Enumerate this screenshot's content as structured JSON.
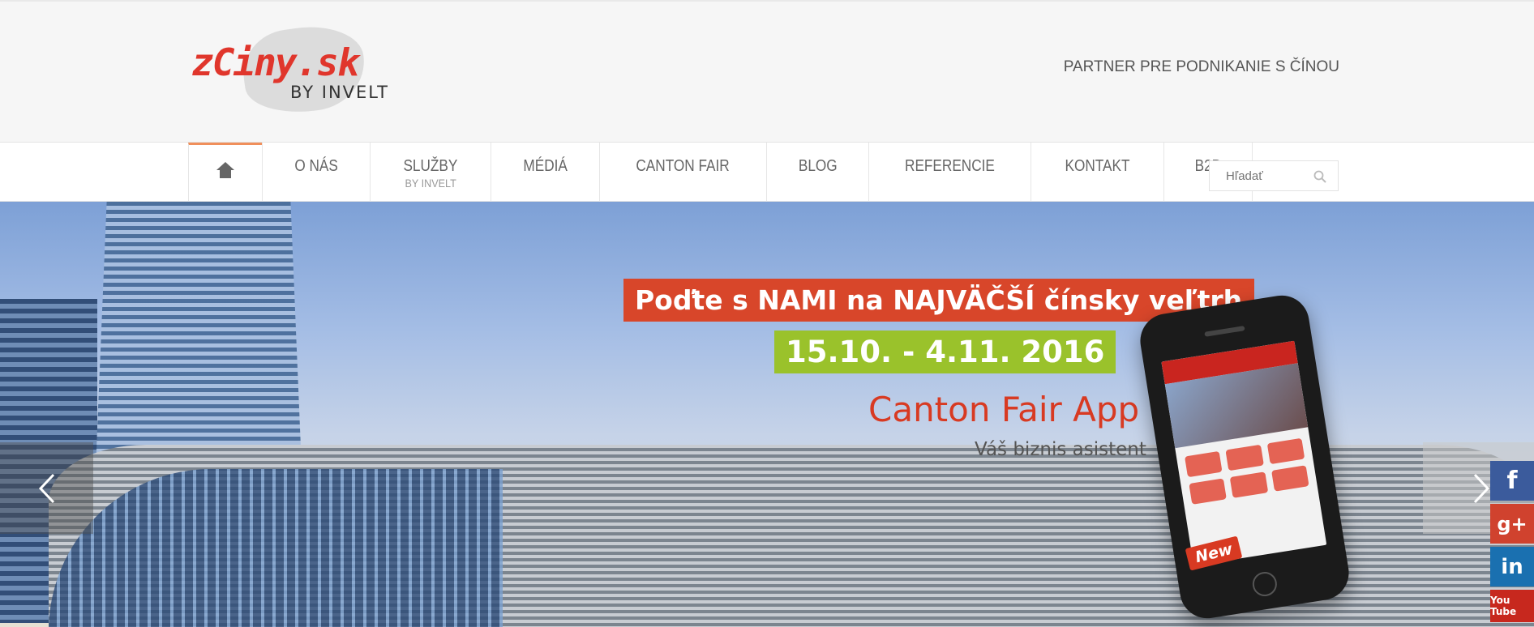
{
  "header": {
    "logo_brand": "zCiny.sk",
    "logo_sub": "BY INVELT",
    "tagline": "PARTNER PRE PODNIKANIE S ČÍNOU"
  },
  "nav": {
    "items": [
      {
        "label": "",
        "icon": "home-icon"
      },
      {
        "label": "O NÁS"
      },
      {
        "label": "SLUŽBY",
        "sub": "BY INVELT"
      },
      {
        "label": "MÉDIÁ"
      },
      {
        "label": "CANTON FAIR"
      },
      {
        "label": "BLOG"
      },
      {
        "label": "REFERENCIE"
      },
      {
        "label": "KONTAKT"
      },
      {
        "label": "B2B"
      }
    ],
    "search_placeholder": "Hľadať"
  },
  "slider": {
    "title": "Poďte s NAMI na NAJVÄČŠÍ čínsky veľtrh",
    "dates": "15.10. - 4.11. 2016",
    "app_name": "Canton Fair App",
    "app_desc": "Váš biznis asistent",
    "badge": "New"
  },
  "social": {
    "facebook": "f",
    "googleplus": "g+",
    "linkedin": "in",
    "youtube": "You Tube"
  },
  "colors": {
    "brand_red": "#d8462a",
    "date_green": "#9ac22b",
    "nav_accent": "#f08f5b"
  }
}
